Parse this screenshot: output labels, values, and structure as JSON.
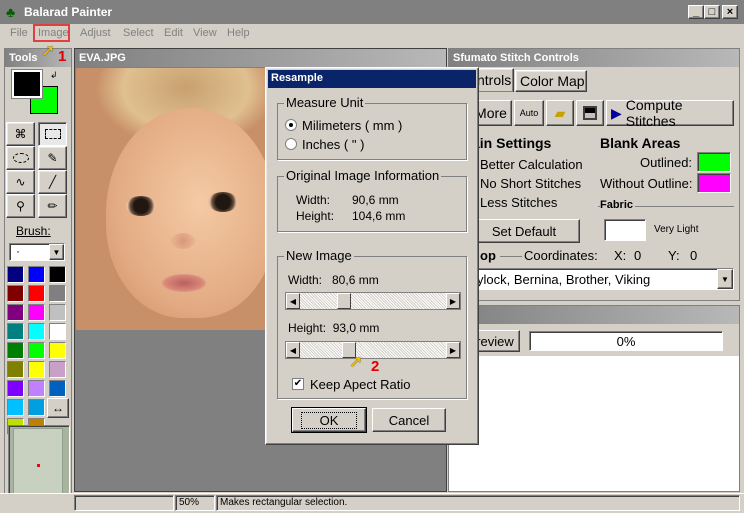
{
  "app": {
    "title": "Balarad Painter"
  },
  "menu": [
    "File",
    "Image",
    "Adjust",
    "Select",
    "Edit",
    "View",
    "Help"
  ],
  "tools_panel": {
    "title": "Tools",
    "brush_label": "Brush:",
    "brush_value": "·"
  },
  "palette": [
    "#000080",
    "#0000ff",
    "#000000",
    "#800000",
    "#ff0000",
    "#808080",
    "#800080",
    "#ff00ff",
    "#c0c0c0",
    "#008080",
    "#00ffff",
    "#ffffff",
    "#008000",
    "#00ff00",
    "#ffff00",
    "#808000",
    "#ffff00",
    "#c8a0c8",
    "#8000ff",
    "#c080ff",
    "#0060c0",
    "#00c0ff",
    "#00a0e0",
    "#80c000",
    "#c0e000",
    "#c08000",
    "#e0e000"
  ],
  "document": {
    "title": "EVA.JPG"
  },
  "status": {
    "zoom": "50%",
    "message": "Makes rectangular selection."
  },
  "stitch": {
    "title": "Sfumato Stitch Controls",
    "tabs": [
      "ntrols",
      "Color Map"
    ],
    "more_label": "More",
    "auto_label": "Auto",
    "compute_label": "Compute Stitches",
    "main_settings": "ain Settings",
    "blank_areas": "Blank Areas",
    "options": [
      "Better Calculation",
      "No Short Stitches",
      "Less Stitches"
    ],
    "outlined_label": "Outlined:",
    "without_outline_label": "Without Outline:",
    "fabric_label": "Fabric",
    "fabric_value": "Very Light",
    "set_default": "Set Default",
    "crop_label": "op",
    "coordinates_label": "Coordinates:",
    "x_label": "X:",
    "x_value": "0",
    "y_label": "Y:",
    "y_value": "0",
    "machine_value": "ylock, Bernina, Brother, Viking",
    "preview_title": "iew",
    "preview_button": "review",
    "progress_text": "0%"
  },
  "dialog": {
    "title": "Resample",
    "measure_unit": "Measure Unit",
    "mm_option": "Milimeters ( mm )",
    "inch_option": "Inches ( \" )",
    "orig_group": "Original Image Information",
    "orig_width_label": "Width:",
    "orig_width_value": "90,6 mm",
    "orig_height_label": "Height:",
    "orig_height_value": "104,6 mm",
    "new_group": "New Image",
    "new_width": "Width:   80,6 mm",
    "new_height": "Height:  93,0 mm",
    "keep_ratio": "Keep Apect Ratio",
    "ok": "OK",
    "cancel": "Cancel"
  },
  "callouts": [
    "1",
    "2"
  ]
}
